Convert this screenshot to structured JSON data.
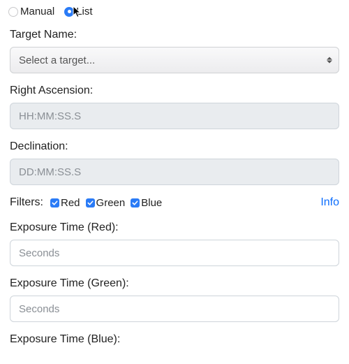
{
  "mode": {
    "manual_label": "Manual",
    "list_label": "List",
    "selected": "list"
  },
  "target_name": {
    "label": "Target Name:",
    "placeholder": "Select a target..."
  },
  "right_ascension": {
    "label": "Right Ascension:",
    "placeholder": "HH:MM:SS.S",
    "value": ""
  },
  "declination": {
    "label": "Declination:",
    "placeholder": "DD:MM:SS.S",
    "value": ""
  },
  "filters": {
    "label": "Filters:",
    "red_label": "Red",
    "green_label": "Green",
    "blue_label": "Blue",
    "red_checked": true,
    "green_checked": true,
    "blue_checked": true,
    "info_label": "Info"
  },
  "exposure_red": {
    "label": "Exposure Time (Red):",
    "placeholder": "Seconds",
    "value": ""
  },
  "exposure_green": {
    "label": "Exposure Time (Green):",
    "placeholder": "Seconds",
    "value": ""
  },
  "exposure_blue": {
    "label": "Exposure Time (Blue):"
  }
}
